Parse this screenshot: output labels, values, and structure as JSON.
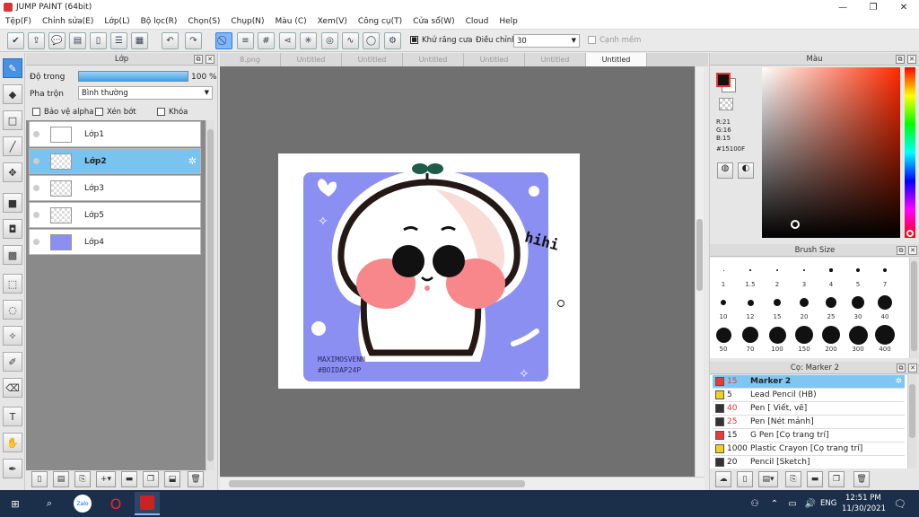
{
  "window": {
    "title": "JUMP PAINT (64bit)",
    "icon": "jump-paint-icon",
    "controls": [
      "minimize",
      "maximize",
      "close"
    ]
  },
  "menu": [
    "Tệp(F)",
    "Chỉnh sửa(E)",
    "Lớp(L)",
    "Bộ lọc(R)",
    "Chọn(S)",
    "Chụp(N)",
    "Màu (C)",
    "Xem(V)",
    "Công cụ(T)",
    "Cửa sổ(W)",
    "Cloud",
    "Help"
  ],
  "toolbar": {
    "antialias_label": "Khử răng cưa",
    "adjust_label": "Điều chỉnh",
    "adjust_value": "30",
    "snap_label": "Cạnh mềm"
  },
  "layer_panel": {
    "title": "Lớp",
    "opacity_label": "Độ trong",
    "opacity_value": "100 %",
    "opacity_fraction": 1.0,
    "blend_label": "Pha trộn",
    "blend_value": "Bình thường",
    "protect_alpha": "Bảo vệ alpha",
    "clip": "Xén bớt",
    "lock": "Khóa",
    "layers": [
      {
        "name": "Lớp1",
        "selected": false
      },
      {
        "name": "Lớp2",
        "selected": true
      },
      {
        "name": "Lớp3",
        "selected": false
      },
      {
        "name": "Lớp5",
        "selected": false
      },
      {
        "name": "Lớp4",
        "selected": false
      }
    ]
  },
  "tabs": [
    {
      "label": "8.png",
      "active": false
    },
    {
      "label": "Untitled",
      "active": false
    },
    {
      "label": "Untitled",
      "active": false
    },
    {
      "label": "Untitled",
      "active": false
    },
    {
      "label": "Untitled",
      "active": false
    },
    {
      "label": "Untitled",
      "active": false
    },
    {
      "label": "Untitled",
      "active": true
    }
  ],
  "artwork": {
    "hihi_text": "hihi",
    "signature_line1": "MAXIMOSVENN",
    "signature_line2": "#BOIDAP24P",
    "bg_color": "#8b8ff2"
  },
  "color_panel": {
    "title": "Màu",
    "r": "R:21",
    "g": "G:16",
    "b": "B:15",
    "hex": "#15100F",
    "main_color": "#15100F"
  },
  "brush_size": {
    "title": "Brush Size",
    "sizes": [
      "1",
      "1.5",
      "2",
      "3",
      "4",
      "5",
      "7",
      "10",
      "12",
      "15",
      "20",
      "25",
      "30",
      "40",
      "50",
      "70",
      "100",
      "150",
      "200",
      "300",
      "400"
    ]
  },
  "brush_list": {
    "title": "Cọ: Marker 2",
    "items": [
      {
        "size": "15",
        "name": "Marker 2",
        "color": "#e83a3a",
        "selected": true
      },
      {
        "size": "5",
        "name": "Lead Pencil (HB)",
        "color": "#f0d020",
        "selected": false
      },
      {
        "size": "40",
        "name": "Pen [ Viết, vẽ]",
        "color": "#333333",
        "selected": false
      },
      {
        "size": "25",
        "name": "Pen [Nét mảnh]",
        "color": "#333333",
        "selected": false
      },
      {
        "size": "15",
        "name": "G Pen [Cọ trang trí]",
        "color": "#e83a3a",
        "selected": false
      },
      {
        "size": "1000",
        "name": "Plastic Crayon [Cọ trang trí]",
        "color": "#f0d020",
        "selected": false
      },
      {
        "size": "20",
        "name": "Pencil [Sketch]",
        "color": "#333333",
        "selected": false
      }
    ]
  },
  "taskbar": {
    "time": "12:51 PM",
    "date": "11/30/2021",
    "lang": "ENG",
    "apps": [
      "zalo",
      "opera",
      "jump-paint"
    ]
  }
}
